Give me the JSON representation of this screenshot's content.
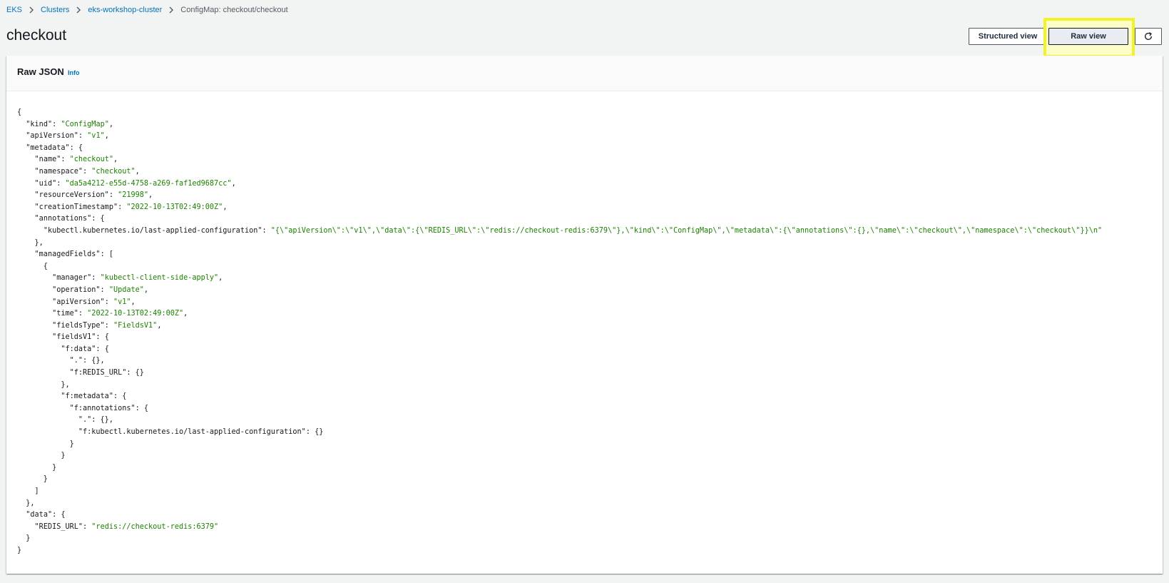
{
  "breadcrumb": {
    "items": [
      "EKS",
      "Clusters",
      "eks-workshop-cluster"
    ],
    "current": "ConfigMap: checkout/checkout"
  },
  "page": {
    "title": "checkout"
  },
  "toolbar": {
    "structured_view_label": "Structured view",
    "raw_view_label": "Raw view",
    "refresh_icon": "refresh-icon"
  },
  "panel": {
    "title": "Raw JSON",
    "info_label": "Info"
  },
  "configmap": {
    "kind": "ConfigMap",
    "apiVersion": "v1",
    "metadata": {
      "name": "checkout",
      "namespace": "checkout",
      "uid": "da5a4212-e55d-4758-a269-faf1ed9687cc",
      "resourceVersion": "21998",
      "creationTimestamp": "2022-10-13T02:49:00Z",
      "annotations": {
        "kubectl.kubernetes.io/last-applied-configuration": "{\"apiVersion\":\"v1\",\"data\":{\"REDIS_URL\":\"redis://checkout-redis:6379\"},\"kind\":\"ConfigMap\",\"metadata\":{\"annotations\":{},\"name\":\"checkout\",\"namespace\":\"checkout\"}}\n"
      },
      "managedFields": [
        {
          "manager": "kubectl-client-side-apply",
          "operation": "Update",
          "apiVersion": "v1",
          "time": "2022-10-13T02:49:00Z",
          "fieldsType": "FieldsV1",
          "fieldsV1": {
            "f:data": {
              ".": {},
              "f:REDIS_URL": {}
            },
            "f:metadata": {
              "f:annotations": {
                ".": {},
                "f:kubectl.kubernetes.io/last-applied-configuration": {}
              }
            }
          }
        }
      ]
    },
    "data": {
      "REDIS_URL": "redis://checkout-redis:6379"
    }
  },
  "colors": {
    "link": "#0073bb",
    "json_string": "#1d8102",
    "highlight": "#f2f22b",
    "background": "#f2f3f3"
  }
}
